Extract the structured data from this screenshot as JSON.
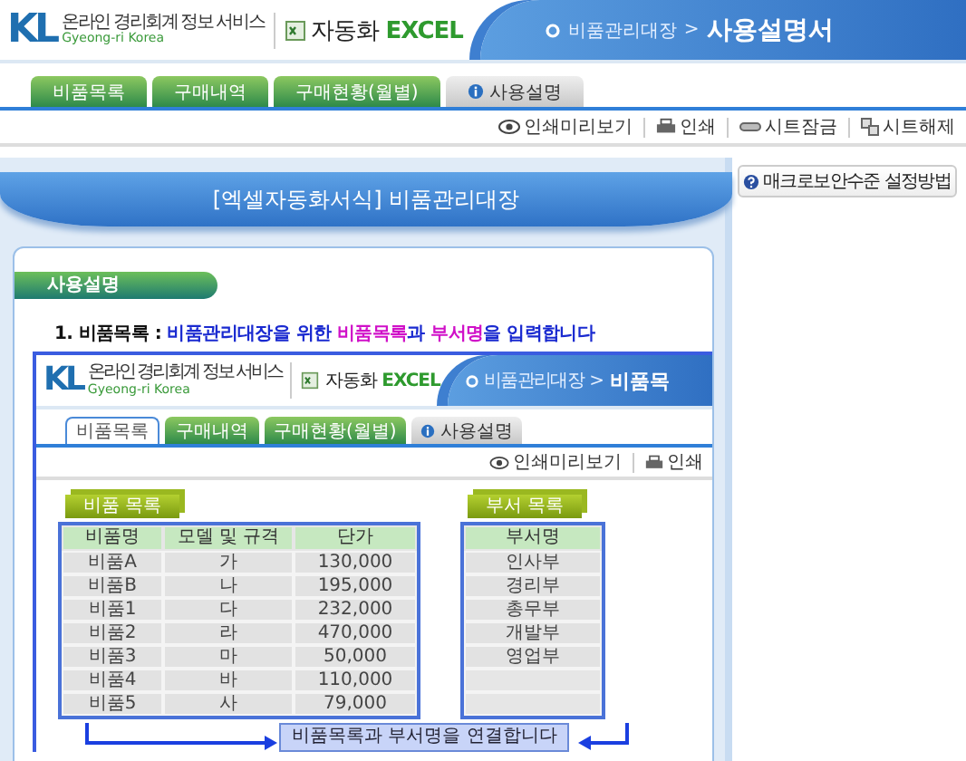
{
  "header": {
    "logo_mark": "KL",
    "logo_tagline": "온라인 경리회계 정보 서비스",
    "logo_sub": "Gyeong-ri Korea",
    "product": "자동화",
    "product_accent": "EXCEL",
    "breadcrumb": {
      "parent": "비품관리대장",
      "separator": ">",
      "current": "사용설명서"
    }
  },
  "tabs": [
    {
      "label": "비품목록",
      "kind": "page",
      "selected": false
    },
    {
      "label": "구매내역",
      "kind": "page",
      "selected": false
    },
    {
      "label": "구매현황(월별)",
      "kind": "page",
      "selected": false
    },
    {
      "label": "사용설명",
      "kind": "help",
      "selected": false
    }
  ],
  "toolbar": [
    "인쇄미리보기",
    "인쇄",
    "시트잠금",
    "시트해제"
  ],
  "side_button": "매크로보안수준 설정방법",
  "banner": "[엑셀자동화서식] 비품관리대장",
  "section": "사용설명",
  "step": {
    "segments": [
      {
        "text": "1. 비품목록 : ",
        "kind": "label"
      },
      {
        "text": "비품관리대장을 위한 ",
        "kind": "plain"
      },
      {
        "text": "비품목록",
        "kind": "highlight"
      },
      {
        "text": "과 ",
        "kind": "plain"
      },
      {
        "text": "부서명",
        "kind": "highlight"
      },
      {
        "text": "을 입력합니다",
        "kind": "plain"
      }
    ]
  },
  "screenshot": {
    "header": {
      "logo_mark": "KL",
      "logo_tagline": "온라인 경리회계 정보 서비스",
      "logo_sub": "Gyeong-ri Korea",
      "product": "자동화",
      "product_accent": "EXCEL",
      "breadcrumb": {
        "parent": "비품관리대장",
        "separator": ">",
        "current": "비품목"
      }
    },
    "tabs": [
      {
        "label": "비품목록",
        "kind": "page",
        "selected": true
      },
      {
        "label": "구매내역",
        "kind": "page",
        "selected": false
      },
      {
        "label": "구매현황(월별)",
        "kind": "page",
        "selected": false
      },
      {
        "label": "사용설명",
        "kind": "help",
        "selected": false
      }
    ],
    "toolbar": [
      "인쇄미리보기",
      "인쇄"
    ],
    "items_table": {
      "title": "비품 목록",
      "columns": [
        "비품명",
        "모델 및 규격",
        "단가"
      ],
      "rows": [
        [
          "비품A",
          "가",
          "130,000"
        ],
        [
          "비품B",
          "나",
          "195,000"
        ],
        [
          "비품1",
          "다",
          "232,000"
        ],
        [
          "비품2",
          "라",
          "470,000"
        ],
        [
          "비품3",
          "마",
          "50,000"
        ],
        [
          "비품4",
          "바",
          "110,000"
        ],
        [
          "비품5",
          "사",
          "79,000"
        ]
      ]
    },
    "dept_table": {
      "title": "부서 목록",
      "columns": [
        "부서명"
      ],
      "rows": [
        [
          "인사부"
        ],
        [
          "경리부"
        ],
        [
          "총무부"
        ],
        [
          "개발부"
        ],
        [
          "영업부"
        ]
      ]
    },
    "link_note": "비품목록과 부서명을 연결합니다"
  }
}
